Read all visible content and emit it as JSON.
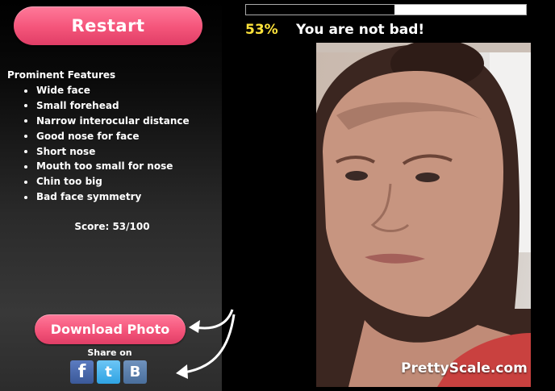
{
  "buttons": {
    "restart": "Restart",
    "download": "Download Photo"
  },
  "features": {
    "heading": "Prominent Features",
    "items": [
      "Wide face",
      "Small forehead",
      "Narrow interocular distance",
      "Good nose for face",
      "Short nose",
      "Mouth too small for nose",
      "Chin too big",
      "Bad face symmetry"
    ]
  },
  "score": {
    "text": "Score: 53/100",
    "progress_fraction": 0.53,
    "percent_label": "53%",
    "verdict": "You are not bad!"
  },
  "share": {
    "label": "Share on",
    "icons": [
      {
        "name": "facebook-icon",
        "glyph": "f",
        "color": "#3b5998"
      },
      {
        "name": "twitter-icon",
        "glyph": "t",
        "color": "#2fa3e3"
      },
      {
        "name": "vk-icon",
        "glyph": "B",
        "color": "#4a6f9c"
      }
    ]
  },
  "watermark": "PrettyScale.com",
  "colors": {
    "button_pink": "#f4547a",
    "percent_yellow": "#ffe33b"
  }
}
